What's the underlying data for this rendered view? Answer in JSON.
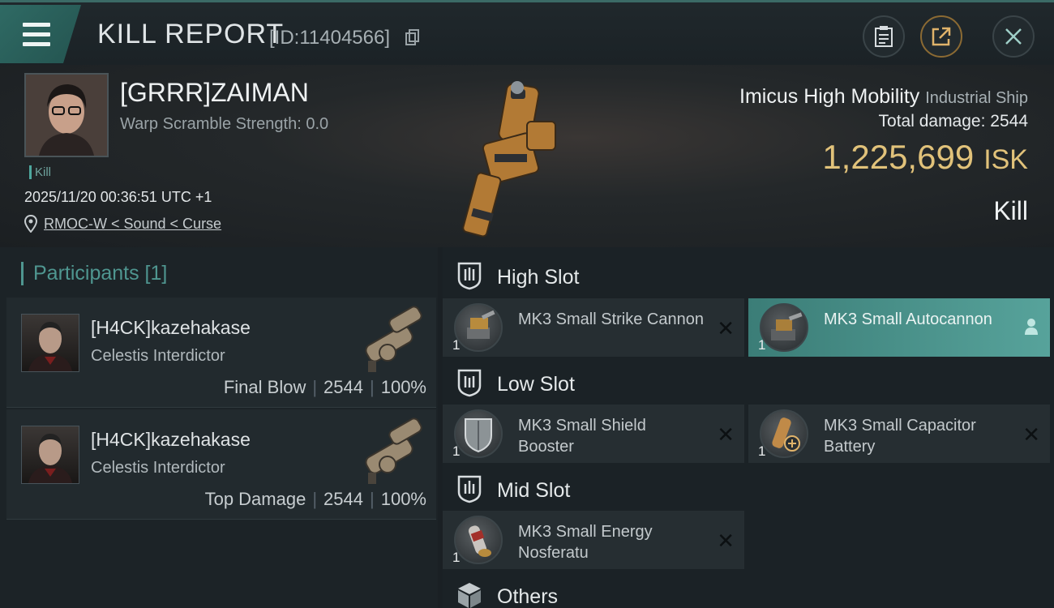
{
  "header": {
    "title": "KILL REPORT",
    "report_id": "[ID:11404566]"
  },
  "victim": {
    "name": "[GRRR]ZAIMAN",
    "warp_scramble": "Warp Scramble Strength: 0.0",
    "tag": "Kill",
    "datetime": "2025/11/20 00:36:51 UTC +1",
    "location": "RMOC-W < Sound < Curse",
    "ship_name": "Imicus High Mobility",
    "ship_class": "Industrial Ship",
    "total_damage_label": "Total damage:",
    "total_damage": "2544",
    "isk_value": "1,225,699",
    "isk_unit": "ISK",
    "result": "Kill"
  },
  "participants": {
    "title": "Participants [1]",
    "rows": [
      {
        "name": "[H4CK]kazehakase",
        "ship": "Celestis Interdictor",
        "role": "Final Blow",
        "damage": "2544",
        "percent": "100%"
      },
      {
        "name": "[H4CK]kazehakase",
        "ship": "Celestis Interdictor",
        "role": "Top Damage",
        "damage": "2544",
        "percent": "100%"
      }
    ]
  },
  "slots": {
    "high": {
      "label": "High Slot",
      "modules": [
        {
          "name": "MK3 Small Strike Cannon",
          "qty": "1"
        },
        {
          "name": "MK3 Small Autocannon",
          "qty": "1"
        }
      ]
    },
    "low": {
      "label": "Low Slot",
      "modules": [
        {
          "name": "MK3 Small Shield Booster",
          "qty": "1"
        },
        {
          "name": "MK3 Small Capacitor Battery",
          "qty": "1"
        }
      ]
    },
    "mid": {
      "label": "Mid Slot",
      "modules": [
        {
          "name": "MK3 Small Energy Nosferatu",
          "qty": "1"
        }
      ]
    },
    "others": {
      "label": "Others"
    }
  },
  "colors": {
    "accent": "#4f9690",
    "isk": "#e1c27a",
    "active_module": "#57a39b"
  }
}
